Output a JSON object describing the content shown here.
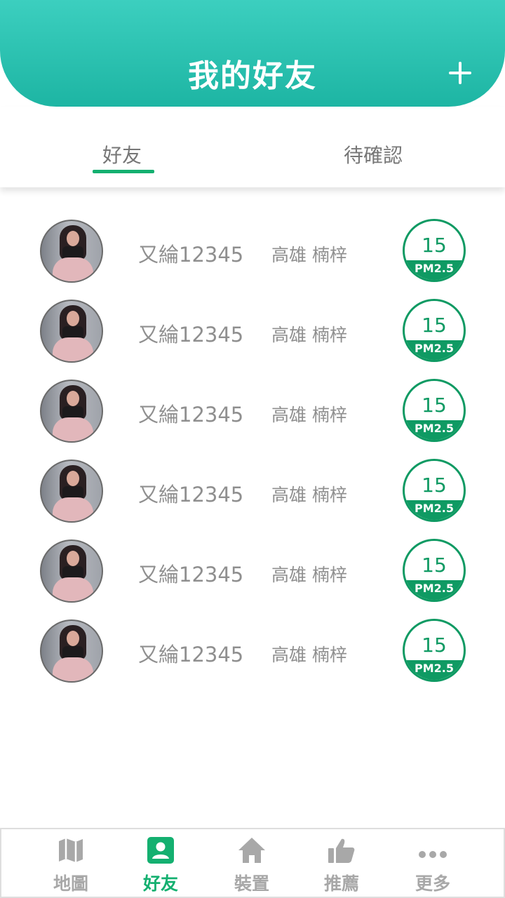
{
  "header": {
    "title": "我的好友",
    "add_icon": "plus-icon"
  },
  "tabs": [
    {
      "label": "好友",
      "active": true
    },
    {
      "label": "待確認",
      "active": false
    }
  ],
  "friends": [
    {
      "name": "又綸12345",
      "location": "高雄 楠梓",
      "aqi_value": "15",
      "aqi_label": "PM2.5"
    },
    {
      "name": "又綸12345",
      "location": "高雄 楠梓",
      "aqi_value": "15",
      "aqi_label": "PM2.5"
    },
    {
      "name": "又綸12345",
      "location": "高雄 楠梓",
      "aqi_value": "15",
      "aqi_label": "PM2.5"
    },
    {
      "name": "又綸12345",
      "location": "高雄 楠梓",
      "aqi_value": "15",
      "aqi_label": "PM2.5"
    },
    {
      "name": "又綸12345",
      "location": "高雄 楠梓",
      "aqi_value": "15",
      "aqi_label": "PM2.5"
    },
    {
      "name": "又綸12345",
      "location": "高雄 楠梓",
      "aqi_value": "15",
      "aqi_label": "PM2.5"
    }
  ],
  "nav": [
    {
      "label": "地圖",
      "icon": "map-icon",
      "active": false
    },
    {
      "label": "好友",
      "icon": "contact-card-icon",
      "active": true
    },
    {
      "label": "裝置",
      "icon": "home-icon",
      "active": false
    },
    {
      "label": "推薦",
      "icon": "thumbs-up-icon",
      "active": false
    },
    {
      "label": "更多",
      "icon": "more-dots-icon",
      "active": false
    }
  ],
  "colors": {
    "header_gradient_top": "#3ccfbf",
    "header_gradient_bottom": "#1db5a3",
    "accent_green": "#14b070",
    "aqi_green": "#0f9a63",
    "text_gray": "#8f8f8f",
    "nav_inactive": "#a8a8a8"
  }
}
